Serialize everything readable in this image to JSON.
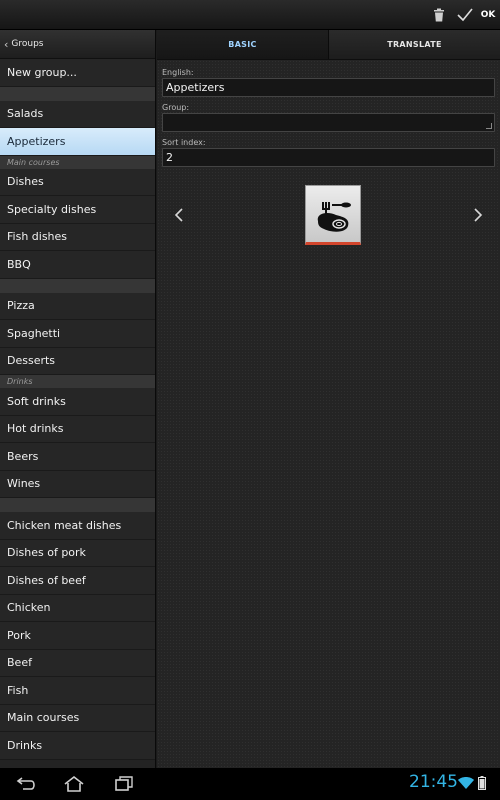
{
  "actionbar": {
    "ok_label": "OK"
  },
  "sidebar": {
    "back_label": "Groups",
    "items": [
      {
        "type": "item",
        "label": "New group..."
      },
      {
        "type": "gap"
      },
      {
        "type": "item",
        "label": "Salads"
      },
      {
        "type": "item",
        "label": "Appetizers",
        "selected": true
      },
      {
        "type": "header",
        "label": "Main courses"
      },
      {
        "type": "item",
        "label": "Dishes"
      },
      {
        "type": "item",
        "label": "Specialty dishes"
      },
      {
        "type": "item",
        "label": "Fish dishes"
      },
      {
        "type": "item",
        "label": "BBQ"
      },
      {
        "type": "gap"
      },
      {
        "type": "item",
        "label": "Pizza"
      },
      {
        "type": "item",
        "label": "Spaghetti"
      },
      {
        "type": "item",
        "label": "Desserts"
      },
      {
        "type": "header",
        "label": "Drinks"
      },
      {
        "type": "item",
        "label": "Soft drinks"
      },
      {
        "type": "item",
        "label": "Hot drinks"
      },
      {
        "type": "item",
        "label": "Beers"
      },
      {
        "type": "item",
        "label": "Wines"
      },
      {
        "type": "gap"
      },
      {
        "type": "item",
        "label": "Chicken meat dishes"
      },
      {
        "type": "item",
        "label": "Dishes of pork"
      },
      {
        "type": "item",
        "label": "Dishes of beef"
      },
      {
        "type": "item",
        "label": "Chicken"
      },
      {
        "type": "item",
        "label": "Pork"
      },
      {
        "type": "item",
        "label": "Beef"
      },
      {
        "type": "item",
        "label": "Fish"
      },
      {
        "type": "item",
        "label": "Main courses"
      },
      {
        "type": "item",
        "label": "Drinks"
      }
    ]
  },
  "tabs": [
    {
      "label": "BASIC",
      "active": true
    },
    {
      "label": "TRANSLATE",
      "active": false
    }
  ],
  "form": {
    "english_label": "English:",
    "english_value": "Appetizers",
    "group_label": "Group:",
    "group_value": "",
    "sort_label": "Sort index:",
    "sort_value": "2"
  },
  "icon_picker": {
    "selected_icon": "steak-fork-knife-icon"
  },
  "statusbar": {
    "time": "21:45"
  },
  "colors": {
    "accent": "#33b5e5",
    "selected_row": "#c4e0f7",
    "icon_underline": "#d2452c"
  }
}
